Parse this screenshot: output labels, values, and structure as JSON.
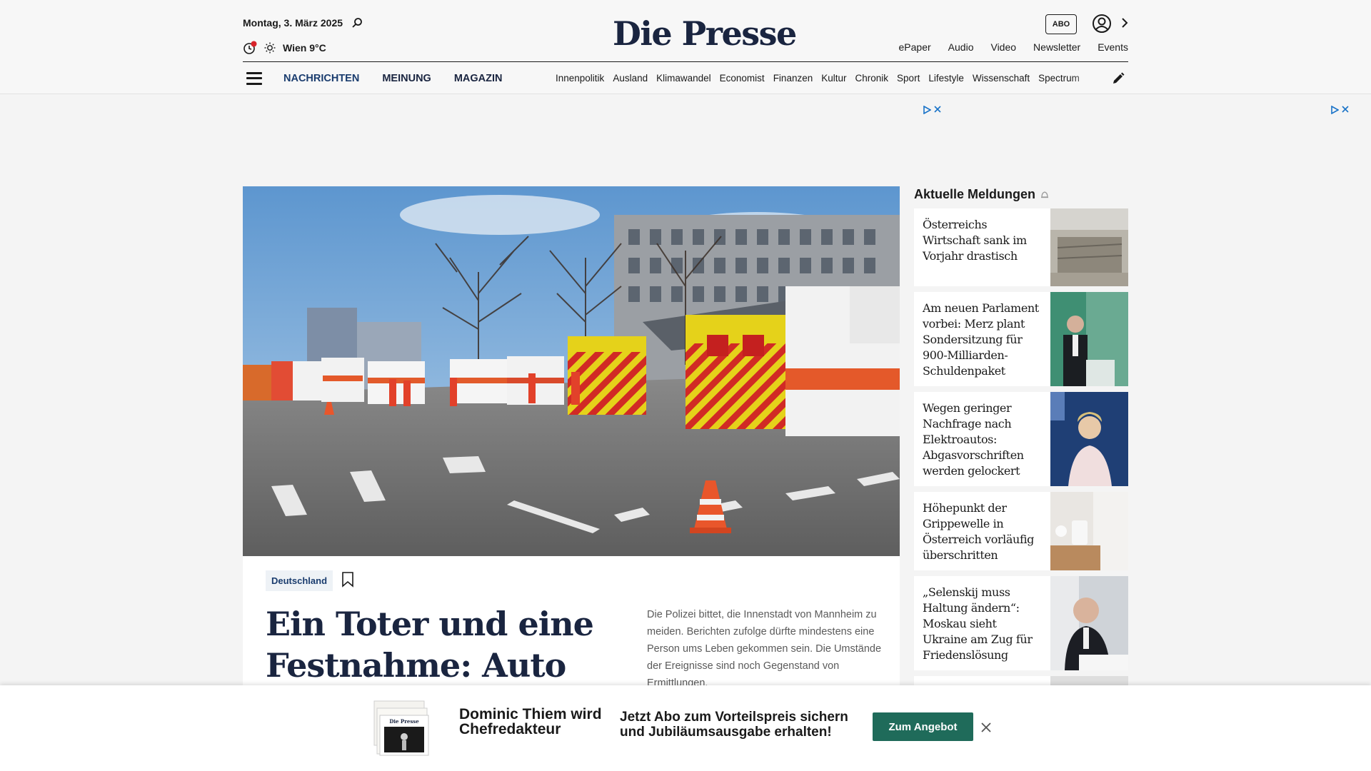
{
  "header": {
    "date": "Montag, 3. März 2025",
    "weather": "Wien 9°C",
    "logo": "Die Presse",
    "abo_label": "ABO",
    "top_links": [
      "ePaper",
      "Audio",
      "Video",
      "Newsletter",
      "Events"
    ]
  },
  "nav": {
    "main": [
      "NACHRICHTEN",
      "MEINUNG",
      "MAGAZIN"
    ],
    "sub": [
      "Innenpolitik",
      "Ausland",
      "Klimawandel",
      "Economist",
      "Finanzen",
      "Kultur",
      "Chronik",
      "Sport",
      "Lifestyle",
      "Wissenschaft",
      "Spectrum"
    ]
  },
  "article": {
    "tag": "Deutschland",
    "headline": "Ein Toter und eine Festnahme: Auto rast",
    "lead": "Die Polizei bittet, die Innenstadt von Mannheim zu meiden. Berichten zufolge dürfte mindestens eine Person ums Leben gekommen sein. Die Umstände der Ereignisse sind noch Gegenstand von Ermittlungen."
  },
  "sidebar": {
    "title": "Aktuelle Meldungen",
    "items": [
      {
        "title": "Österreichs Wirtschaft sank im Vorjahr drastisch"
      },
      {
        "title": "Am neuen Parlament vorbei: Merz plant Sondersitzung für 900-Milliarden-Schuldenpaket"
      },
      {
        "title": "Wegen geringer Nachfrage nach Elektroautos: Abgasvorschriften werden gelockert"
      },
      {
        "title": "Höhepunkt der Grippewelle in Österreich vorläufig überschritten"
      },
      {
        "title": "„Selenskij muss Haltung ändern“: Moskau sieht Ukraine am Zug für Friedenslösung"
      }
    ]
  },
  "promo": {
    "paper_masthead": "Die Presse",
    "title": "Dominic Thiem wird Chefredakteur",
    "text": "Jetzt Abo zum Vorteilspreis sichern und Jubiläumsausgabe erhalten!",
    "button": "Zum Angebot"
  },
  "colors": {
    "brand_navy": "#1a2540",
    "nav_blue": "#1a3c6e",
    "cta_green": "#1f6b5a"
  }
}
